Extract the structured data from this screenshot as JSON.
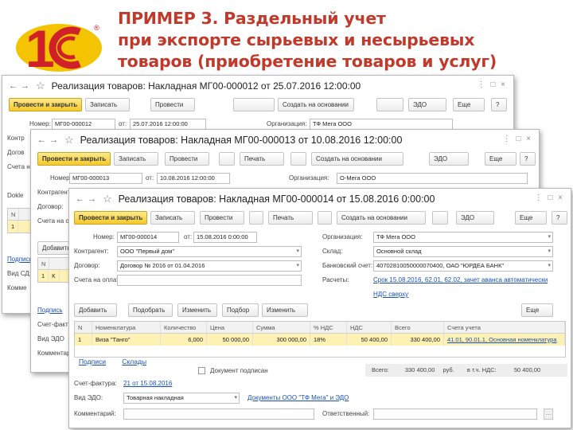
{
  "slide": {
    "title_line1": "ПРИМЕР 3. Раздельный учет",
    "title_line2": "при экспорте сырьевых и несырьевых",
    "title_line3": "товаров (приобретение товаров и услуг)"
  },
  "logo": {
    "text": "1С",
    "registered": "®"
  },
  "colors": {
    "title": "#c0392b",
    "primary_button": "#f5c92a",
    "selected_row": "#fdf1b4",
    "link": "#1a4fb8",
    "logo_red": "#d0202a",
    "logo_yellow": "#f5c400"
  },
  "nav_glyphs": {
    "back": "←",
    "forward": "→",
    "star": "☆",
    "window_controls": "⋮ □ ×",
    "dropdown": "▾",
    "more": "…"
  },
  "doc1": {
    "title": "Реализация товаров: Накладная МГ00-000012 от 25.07.2016 12:00:00",
    "toolbar": [
      "Провести и закрыть",
      "Записать",
      "Провести",
      "",
      "Создать на основании",
      "",
      "ЭДО",
      "Еще",
      "?"
    ],
    "number_label": "Номер:",
    "number_value": "МГ00-000012",
    "date_label": "от:",
    "date_value": "25.07.2016 12:00:00",
    "org_label": "Организация:",
    "org_value": "ТФ Мега ООО",
    "left_labels": [
      "Контр",
      "Догов",
      "Счета на"
    ],
    "table_header": [
      "N"
    ],
    "table_row": [
      "1"
    ],
    "bottom_labels": [
      "Подпись",
      "Вид СД:",
      "Комме"
    ],
    "section_left": "Dokle"
  },
  "doc2": {
    "title": "Реализация товаров: Накладная МГ00-000013 от 10.08.2016 12:00:00",
    "toolbar": [
      "Провести и закрыть",
      "Записать",
      "Провести",
      "",
      "Печать",
      "",
      "Создать на основании",
      "ЭДО",
      "Еще",
      "?"
    ],
    "number_label": "Номер:",
    "number_value": "МГ00-000013",
    "date_label": "от:",
    "date_value": "10.08.2016 12:00:00",
    "org_label": "Организация:",
    "org_value": "О-Мега ООО",
    "left_labels": [
      "Контрагент",
      "Договор:",
      "Счета на оплату:"
    ],
    "add_button": "Добавить",
    "table_header": [
      "N"
    ],
    "table_row": [
      "1",
      "К"
    ],
    "tabs_label": "Подпись",
    "bottom_labels": [
      "Счет-фактура",
      "Вид ЭДО",
      "Комментарий"
    ]
  },
  "doc3": {
    "title": "Реализация товаров: Накладная МГ00-000014 от 15.08.2016 0:00:00",
    "toolbar": [
      "Провести и закрыть",
      "Записать",
      "Провести",
      "",
      "Печать",
      "",
      "Создать на основании",
      "",
      "ЭДО",
      "Еще",
      "?"
    ],
    "number_label": "Номер:",
    "number_value": "МГ00-000014",
    "date_label": "от:",
    "date_value": "15.08.2016 0:00:00",
    "org_label": "Организация:",
    "org_value": "ТФ Мега ООО",
    "contractor_label": "Контрагент:",
    "contractor_value": "ООО \"Первый дом\"",
    "warehouse_label": "Склад:",
    "warehouse_value": "Основной склад",
    "contract_label": "Договор:",
    "contract_value": "Договор № 2016 от 01.04.2016",
    "bank_label": "Банковский счет:",
    "bank_value": "40702810050000070400, ОАО \"ЮРДЕА БАНК\"",
    "invoices_label": "Счета на оплату:",
    "settlements_label": "Расчеты:",
    "settlements_value": "Срок 15.08.2016, 62.01, 62.02, зачет аванса автоматически",
    "vat_link": "НДС сверху",
    "table_buttons": [
      "Добавить",
      "Подобрать",
      "Изменить",
      "Подбор",
      "Изменить",
      "Еще"
    ],
    "columns": [
      "N",
      "Номенклатура",
      "Количество",
      "Цена",
      "Сумма",
      "% НДС",
      "НДС",
      "Всего",
      "Счета учета"
    ],
    "row": [
      "1",
      "Виза \"Танго\"",
      "6,000",
      "50 000,00",
      "300 000,00",
      "18%",
      "50 400,00",
      "330 400,00",
      "41.01, 90.01.1, Основная номенклатура"
    ],
    "bottom_tabs": [
      "Подписи",
      "Склады"
    ],
    "doc_signed_label": "Документ подписан",
    "total_label": "Всего:",
    "total_value": "330 400,00",
    "currency": "руб.",
    "vat_total_label": "в т.ч. НДС:",
    "vat_total_value": "50 400,00",
    "invoice_label": "Счет-фактура:",
    "invoice_value": "21 от 15.08.2016",
    "edo_label": "Вид ЭДО:",
    "edo_value": "Товарная накладная",
    "edo_note": "Документы ООО \"ТФ Мега\" и ЭДО",
    "comment_label": "Комментарий:",
    "responsible_label": "Ответственный:"
  }
}
